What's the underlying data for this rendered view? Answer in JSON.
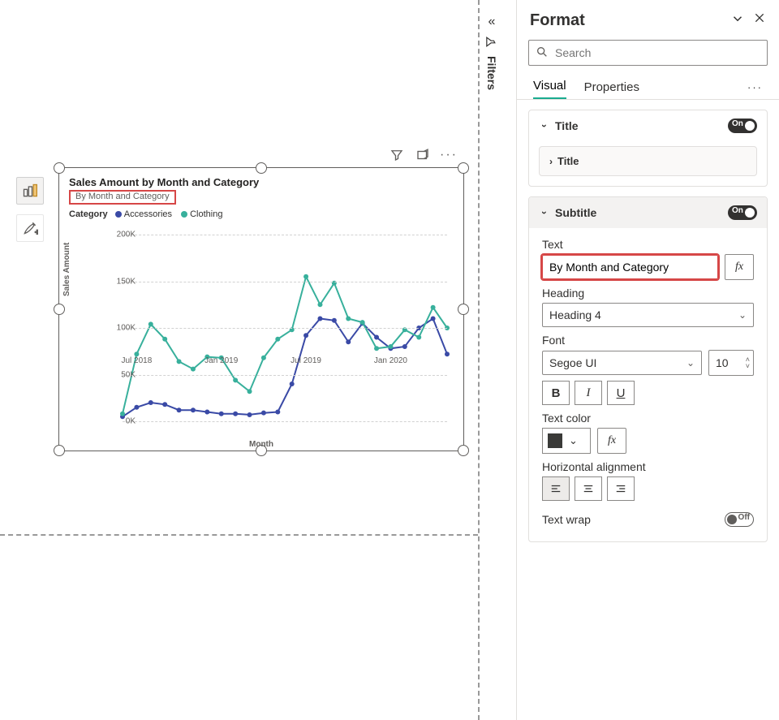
{
  "chart_data": {
    "type": "line",
    "title": "Sales Amount by Month and Category",
    "subtitle": "By Month and Category",
    "xlabel": "Month",
    "ylabel": "Sales Amount",
    "ylim": [
      0,
      200000
    ],
    "y_ticks": [
      "0K",
      "50K",
      "100K",
      "150K",
      "200K"
    ],
    "x_ticks": [
      "Jul 2018",
      "Jan 2019",
      "Jul 2019",
      "Jan 2020"
    ],
    "legend_title": "Category",
    "categories": [
      "2018-06",
      "2018-07",
      "2018-08",
      "2018-09",
      "2018-10",
      "2018-11",
      "2018-12",
      "2019-01",
      "2019-02",
      "2019-03",
      "2019-04",
      "2019-05",
      "2019-06",
      "2019-07",
      "2019-08",
      "2019-09",
      "2019-10",
      "2019-11",
      "2019-12",
      "2020-01",
      "2020-02",
      "2020-03",
      "2020-04",
      "2020-05"
    ],
    "series": [
      {
        "name": "Accessories",
        "color": "#3a4aa6",
        "values": [
          5000,
          15000,
          20000,
          18000,
          12000,
          12000,
          10000,
          8000,
          8000,
          7000,
          9000,
          10000,
          40000,
          92000,
          110000,
          108000,
          85000,
          105000,
          90000,
          78000,
          80000,
          100000,
          110000,
          72000
        ]
      },
      {
        "name": "Clothing",
        "color": "#38b09c",
        "values": [
          8000,
          72000,
          104000,
          88000,
          64000,
          56000,
          69000,
          68000,
          44000,
          32000,
          68000,
          88000,
          98000,
          155000,
          125000,
          148000,
          110000,
          106000,
          78000,
          80000,
          98000,
          90000,
          122000,
          100000
        ]
      }
    ]
  },
  "filters": {
    "label": "Filters"
  },
  "format_pane": {
    "title": "Format",
    "search_placeholder": "Search",
    "tabs": {
      "visual": "Visual",
      "properties": "Properties"
    },
    "title_card": {
      "label": "Title",
      "on": "On",
      "sub_label": "Title"
    },
    "subtitle_card": {
      "label": "Subtitle",
      "on": "On",
      "text_label": "Text",
      "text_value": "By Month and Category",
      "heading_label": "Heading",
      "heading_value": "Heading 4",
      "font_label": "Font",
      "font_value": "Segoe UI",
      "font_size": "10",
      "bold": "B",
      "italic": "I",
      "underline": "U",
      "text_color_label": "Text color",
      "halign_label": "Horizontal alignment",
      "wrap_label": "Text wrap",
      "wrap_state": "Off",
      "fx": "fx"
    }
  }
}
